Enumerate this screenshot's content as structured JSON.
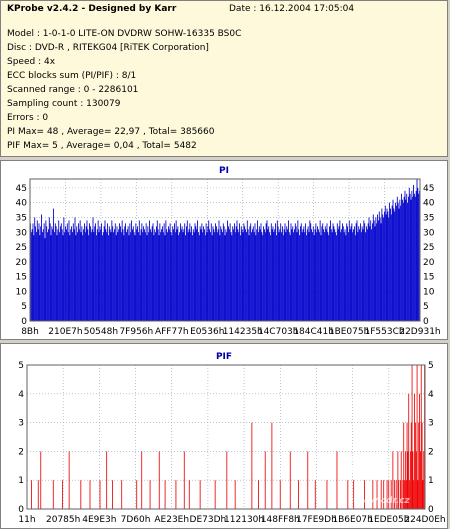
{
  "header": {
    "title": "KProbe v2.4.2 - Designed by Karr",
    "date": "Date : 16.12.2004 17:05:04",
    "lines": [
      "Model : 1-0-1-0 LITE-ON DVDRW SOHW-16335 BS0C",
      "Disc : DVD-R , RITEKG04 [RiTEK Corporation]",
      "Speed : 4x",
      "ECC blocks sum (PI/PIF) : 8/1",
      "Scanned range : 0 - 2286101",
      "Sampling count : 130079",
      "Errors : 0",
      "PI Max= 48 , Average= 22,97 , Total= 385660",
      "PIF Max= 5 , Average= 0,04 , Total= 5482"
    ],
    "background": "#fff9db"
  },
  "watermark": {
    "text": "CD",
    "subtext": "www.cdr.cz"
  },
  "chart_data": [
    {
      "type": "bar",
      "title": "PI",
      "color": "#0000cc",
      "xlabel": "",
      "ylabel": "",
      "ylim": [
        0,
        48
      ],
      "y_ticks": [
        0,
        5,
        10,
        15,
        20,
        25,
        30,
        35,
        40,
        45
      ],
      "x_tick_labels": [
        "8Bh",
        "210E7h",
        "50548h",
        "7F956h",
        "AFF77h",
        "E0536h",
        "114235h",
        "14C703h",
        "184C41h",
        "1BE075h",
        "1F553Ch",
        "22D931h"
      ],
      "grid": true,
      "series": [
        {
          "values": [
            33,
            30,
            31,
            33,
            29,
            35,
            32,
            30,
            34,
            31,
            33,
            29,
            32,
            36,
            30,
            31,
            33,
            28,
            34,
            32,
            30,
            31,
            35,
            33,
            29,
            32,
            31,
            38,
            30,
            33,
            32,
            29,
            31,
            34,
            30,
            32,
            33,
            31,
            29,
            35,
            30,
            32,
            31,
            33,
            30,
            34,
            29,
            31,
            32,
            30,
            33,
            31,
            35,
            29,
            32,
            30,
            33,
            31,
            34,
            30,
            32,
            29,
            31,
            33,
            30,
            32,
            34,
            31,
            29,
            33,
            32,
            30,
            31,
            35,
            30,
            32,
            33,
            29,
            31,
            34,
            30,
            32,
            31,
            33,
            29,
            30,
            32,
            34,
            31,
            30,
            33,
            29,
            32,
            31,
            30,
            34,
            32,
            30,
            31,
            33,
            29,
            32,
            30,
            31,
            33,
            32,
            30,
            34,
            31,
            29,
            32,
            33,
            30,
            31,
            32,
            29,
            33,
            30,
            34,
            31,
            32,
            30,
            29,
            33,
            31,
            32,
            30,
            34,
            29,
            31,
            33,
            30,
            32,
            31,
            30,
            33,
            29,
            32,
            30,
            34,
            31,
            30,
            32,
            33,
            29,
            31,
            30,
            32,
            34,
            31,
            29,
            33,
            30,
            31,
            32,
            30,
            33,
            29,
            34,
            31,
            30,
            32,
            31,
            33,
            30,
            29,
            32,
            31,
            33,
            30,
            34,
            31,
            32,
            29,
            30,
            33,
            31,
            32,
            30,
            31,
            33,
            29,
            32,
            34,
            30,
            31,
            33,
            30,
            32,
            29,
            31,
            30,
            33,
            32,
            31,
            34,
            30,
            29,
            32,
            31,
            33,
            30,
            32,
            31,
            29,
            33,
            30,
            32,
            34,
            31,
            30,
            33,
            29,
            32,
            31,
            30,
            33,
            32,
            30,
            31,
            34,
            29,
            32,
            31,
            30,
            33,
            32,
            29,
            31,
            30,
            34,
            32,
            31,
            33,
            30,
            29,
            32,
            31,
            33,
            30,
            32,
            34,
            31,
            30,
            33,
            29,
            32,
            31,
            30,
            33,
            32,
            31,
            30,
            34,
            31,
            29,
            32,
            33,
            30,
            31,
            32,
            30,
            33,
            29,
            31,
            34,
            30,
            32,
            31,
            33,
            30,
            29,
            32,
            31,
            30,
            33,
            34,
            31,
            32,
            30,
            29,
            33,
            31,
            32,
            30,
            31,
            33,
            29,
            34,
            32,
            30,
            31,
            33,
            30,
            32,
            29,
            31,
            33,
            30,
            32,
            31,
            34,
            30,
            29,
            33,
            31,
            32,
            30,
            31,
            33,
            32,
            30,
            34,
            31,
            29,
            32,
            33,
            30,
            31,
            32,
            30,
            33,
            29,
            31,
            32,
            30,
            34,
            33,
            31,
            30,
            32,
            29,
            31,
            33,
            30,
            32,
            31,
            30,
            34,
            29,
            32,
            33,
            31,
            30,
            32,
            31,
            33,
            30,
            29,
            32,
            34,
            31,
            30,
            33,
            32,
            31,
            30,
            29,
            33,
            31,
            32,
            34,
            30,
            31,
            33,
            32,
            30,
            31,
            29,
            33,
            32,
            30,
            34,
            31,
            32,
            33,
            30,
            31,
            32,
            29,
            33,
            34,
            30,
            32,
            31,
            33,
            30,
            32,
            31,
            34,
            33,
            30,
            32,
            31,
            33,
            35,
            32,
            34,
            31,
            33,
            36,
            34,
            32,
            35,
            33,
            36,
            34,
            37,
            35,
            33,
            38,
            36,
            35,
            37,
            39,
            36,
            38,
            37,
            35,
            40,
            38,
            36,
            39,
            41,
            38,
            37,
            40,
            39,
            42,
            40,
            38,
            41,
            39,
            43,
            41,
            40,
            42,
            44,
            41,
            43,
            40,
            42,
            45,
            43,
            41,
            44,
            42,
            46,
            43,
            42,
            44,
            48,
            45,
            43,
            44
          ]
        }
      ]
    },
    {
      "type": "bar",
      "title": "PIF",
      "color": "#ee0000",
      "xlabel": "",
      "ylabel": "",
      "ylim": [
        0,
        5
      ],
      "y_ticks": [
        0,
        1,
        2,
        3,
        4,
        5
      ],
      "x_tick_labels": [
        "11h",
        "20785h",
        "4E9E3h",
        "7D60h",
        "AE23Eh",
        "DE73Dh",
        "112130h",
        "148FF8h",
        "17FE9Dh",
        "1B6E07h",
        "1EDE05h",
        "224D0Eh"
      ],
      "grid": true,
      "series": [
        {
          "values": [
            0,
            0,
            0,
            0,
            0,
            1,
            0,
            0,
            0,
            0,
            0,
            0,
            0,
            1,
            0,
            0,
            2,
            0,
            0,
            0,
            0,
            0,
            0,
            0,
            0,
            0,
            0,
            0,
            0,
            0,
            0,
            1,
            0,
            0,
            0,
            0,
            0,
            0,
            0,
            0,
            0,
            0,
            1,
            0,
            0,
            0,
            0,
            0,
            0,
            0,
            2,
            0,
            0,
            0,
            0,
            0,
            0,
            0,
            0,
            0,
            0,
            0,
            0,
            0,
            1,
            0,
            0,
            0,
            0,
            0,
            0,
            0,
            0,
            0,
            0,
            1,
            0,
            0,
            0,
            0,
            0,
            0,
            0,
            0,
            0,
            0,
            0,
            1,
            0,
            0,
            0,
            0,
            0,
            0,
            0,
            2,
            0,
            0,
            0,
            0,
            0,
            0,
            1,
            0,
            0,
            0,
            0,
            0,
            0,
            0,
            0,
            0,
            0,
            1,
            0,
            0,
            0,
            0,
            0,
            0,
            0,
            0,
            0,
            0,
            0,
            0,
            0,
            0,
            0,
            0,
            0,
            1,
            0,
            0,
            0,
            0,
            0,
            2,
            0,
            0,
            0,
            0,
            0,
            0,
            0,
            0,
            0,
            1,
            0,
            0,
            0,
            0,
            0,
            0,
            0,
            0,
            0,
            0,
            2,
            0,
            0,
            0,
            0,
            0,
            0,
            1,
            0,
            0,
            0,
            0,
            0,
            0,
            0,
            0,
            0,
            0,
            0,
            0,
            1,
            0,
            0,
            0,
            0,
            0,
            0,
            0,
            0,
            0,
            2,
            0,
            0,
            0,
            0,
            0,
            1,
            0,
            0,
            0,
            0,
            0,
            0,
            0,
            0,
            0,
            0,
            0,
            0,
            1,
            0,
            0,
            0,
            0,
            0,
            0,
            0,
            0,
            0,
            0,
            0,
            0,
            0,
            0,
            0,
            0,
            0,
            1,
            0,
            0,
            0,
            0,
            0,
            0,
            0,
            0,
            0,
            0,
            0,
            0,
            0,
            2,
            0,
            0,
            0,
            0,
            0,
            0,
            0,
            0,
            0,
            1,
            0,
            0,
            0,
            0,
            0,
            0,
            0,
            0,
            0,
            0,
            0,
            0,
            0,
            0,
            0,
            0,
            0,
            0,
            0,
            3,
            0,
            0,
            0,
            0,
            0,
            0,
            0,
            1,
            0,
            0,
            0,
            0,
            0,
            0,
            0,
            2,
            0,
            0,
            0,
            0,
            0,
            0,
            0,
            3,
            0,
            0,
            0,
            0,
            0,
            0,
            0,
            0,
            0,
            1,
            0,
            0,
            0,
            0,
            0,
            0,
            0,
            0,
            0,
            0,
            0,
            2,
            0,
            0,
            0,
            0,
            0,
            0,
            0,
            0,
            0,
            1,
            0,
            0,
            0,
            0,
            0,
            0,
            0,
            0,
            0,
            0,
            2,
            0,
            0,
            0,
            0,
            0,
            0,
            0,
            0,
            1,
            0,
            0,
            0,
            0,
            0,
            0,
            0,
            0,
            0,
            0,
            0,
            0,
            0,
            1,
            0,
            0,
            0,
            0,
            0,
            0,
            0,
            0,
            0,
            0,
            0,
            2,
            0,
            0,
            0,
            0,
            0,
            0,
            0,
            0,
            0,
            0,
            0,
            0,
            1,
            0,
            0,
            0,
            0,
            0,
            0,
            1,
            0,
            0,
            0,
            0,
            0,
            0,
            0,
            0,
            0,
            0,
            0,
            0,
            1,
            0,
            0,
            0,
            0,
            0,
            0,
            0,
            0,
            0,
            1,
            0,
            0,
            0,
            0,
            1,
            0,
            0,
            0,
            0,
            1,
            0,
            0,
            1,
            0,
            0,
            0,
            1,
            0,
            1,
            0,
            0,
            1,
            0,
            2,
            0,
            1,
            0,
            1,
            0,
            2,
            1,
            0,
            1,
            2,
            0,
            1,
            3,
            1,
            2,
            1,
            3,
            2,
            4,
            1,
            2,
            3,
            5,
            2,
            1,
            4,
            3,
            2,
            5,
            1,
            3,
            4,
            2,
            5,
            3,
            1,
            2,
            5
          ]
        }
      ]
    }
  ]
}
